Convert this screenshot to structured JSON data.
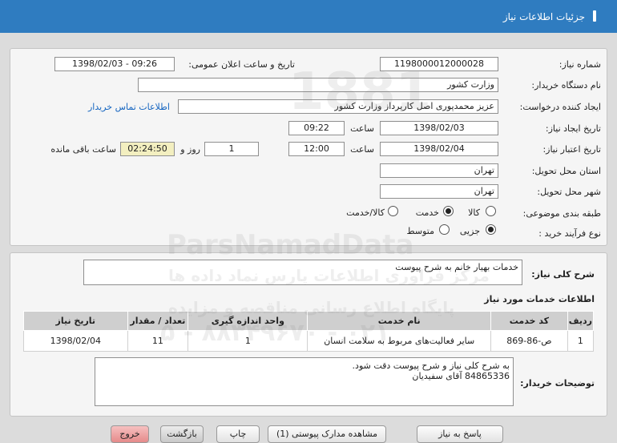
{
  "header": {
    "title": "جزئیات اطلاعات نیاز"
  },
  "form": {
    "need_number_label": "شماره نیاز:",
    "need_number": "1198000012000028",
    "announce_label": "تاریخ و ساعت اعلان عمومی:",
    "announce_value": "1398/02/03 - 09:26",
    "buyer_org_label": "نام دستگاه خریدار:",
    "buyer_org": "وزارت کشور",
    "requester_label": "ایجاد کننده درخواست:",
    "requester": "عزیز محمدپوری اصل کارپرداز وزارت کشور",
    "contact_link": "اطلاعات تماس خریدار",
    "created_label": "تاریخ ایجاد نیاز:",
    "created_date": "1398/02/03",
    "time_label": "ساعت",
    "created_time": "09:22",
    "validity_label": "تاریخ اعتبار نیاز:",
    "validity_date": "1398/02/04",
    "validity_time": "12:00",
    "days_value": "1",
    "days_label": "روز و",
    "remaining_time": "02:24:50",
    "remaining_label": "ساعت باقی مانده",
    "province_label": "استان محل تحویل:",
    "province": "تهران",
    "city_label": "شهر محل تحویل:",
    "city": "تهران",
    "category_label": "طبقه بندی موضوعی:",
    "category_options": [
      "کالا",
      "خدمت",
      "کالا/خدمت"
    ],
    "category_selected": "خدمت",
    "purchase_label": "نوع فرآیند خرید :",
    "purchase_options": [
      "جزیی",
      "متوسط"
    ],
    "purchase_selected": "جزیی"
  },
  "summary": {
    "label": "شرح کلی نیاز:",
    "value": "خدمات بهیار خانم به شرح پیوست"
  },
  "services": {
    "title": "اطلاعات خدمات مورد نیاز",
    "columns": [
      "ردیف",
      "کد خدمت",
      "نام خدمت",
      "واحد اندازه گیری",
      "تعداد / مقدار",
      "تاریخ نیاز"
    ],
    "rows": [
      [
        "1",
        "ص-86-869",
        "سایر فعالیت‌های مربوط به سلامت انسان",
        "1",
        "11",
        "1398/02/04"
      ]
    ]
  },
  "buyer_notes": {
    "label": "توضیحات خریدار:",
    "line1": "به شرح کلی نیاز و شرح پیوست دقت شود.",
    "line2": "84865336 آقای سفیدیان"
  },
  "buttons": {
    "reply": "پاسخ به نیاز",
    "attachments": "مشاهده مدارک پیوستی (1)",
    "print": "چاپ",
    "back": "بازگشت",
    "exit": "خروج"
  },
  "watermark": {
    "line1": "ParsNamadData",
    "line2": "مرکز فراوری اطلاعات پارس نماد داده ها",
    "line3": "پایگاه اطلاع رسانی مناقصه و مزایده",
    "line4": "۰۲۱ - ۸۸۳۴۹۶۷۰ - ۵",
    "line5": "1881"
  }
}
